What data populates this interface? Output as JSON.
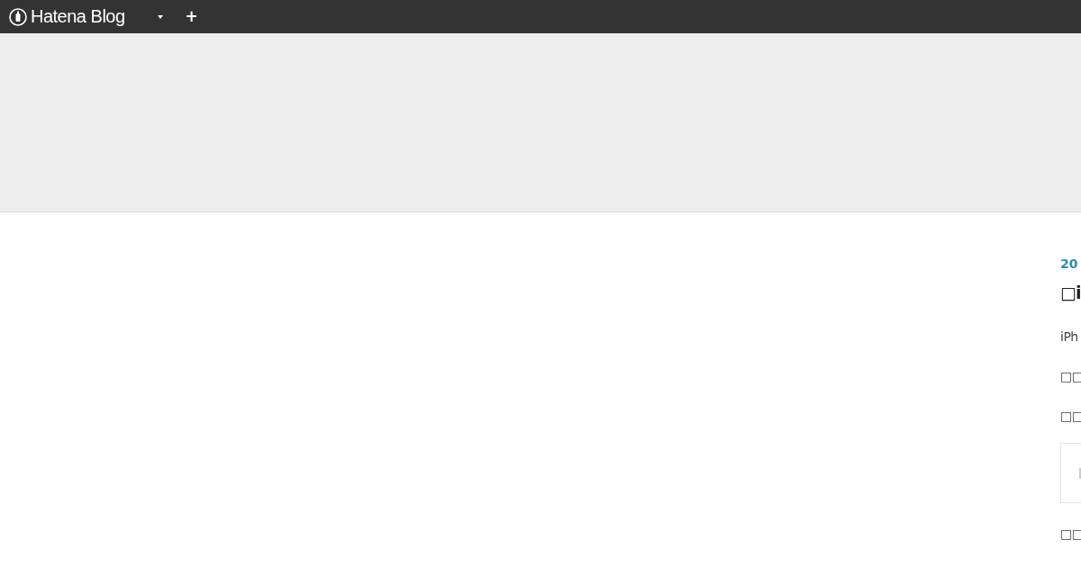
{
  "topbar": {
    "logo": "Hatena Blog",
    "add_symbol": "+"
  },
  "entry": {
    "date": "20",
    "title": "□i",
    "paragraphs": [
      "iPh",
      "□□",
      "□□"
    ],
    "after_card": "□□"
  }
}
